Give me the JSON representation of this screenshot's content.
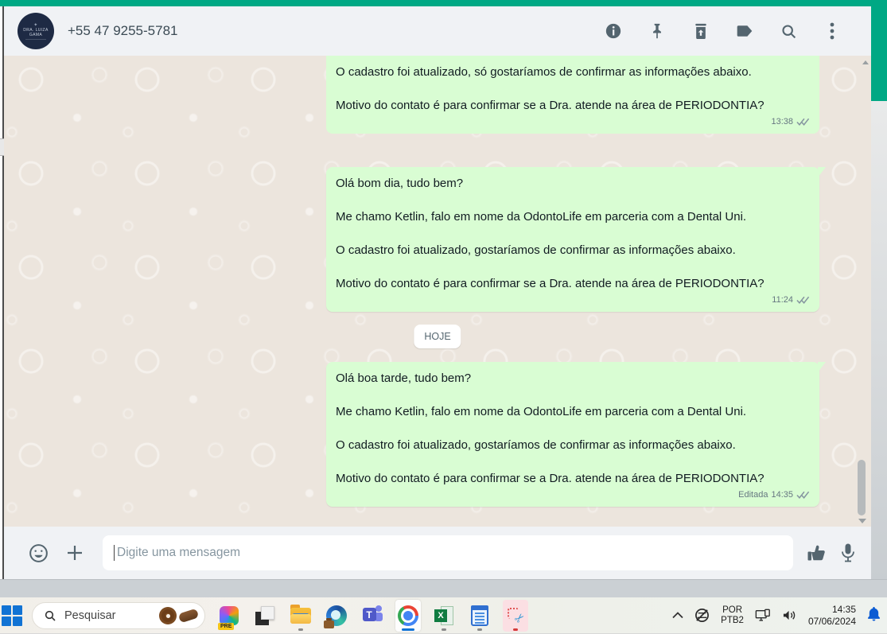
{
  "header": {
    "phone": "+55 47 9255-5781",
    "avatar_text": "DRA. LUIZA GAMA",
    "icons": [
      "info-icon",
      "pin-icon",
      "archive-icon",
      "label-icon",
      "search-icon",
      "kebab-menu-icon"
    ]
  },
  "chat": {
    "date_divider": "HOJE",
    "messages": [
      {
        "paragraphs": [
          "O cadastro foi atualizado, só gostaríamos de confirmar as informações abaixo.",
          "Motivo do contato é para confirmar se a Dra. atende na área de PERIODONTIA?"
        ],
        "time": "13:38",
        "status": "delivered"
      },
      {
        "paragraphs": [
          "Olá bom dia, tudo bem?",
          "Me chamo Ketlin, falo em nome da OdontoLife em parceria com a Dental Uni.",
          "O cadastro foi atualizado, gostaríamos de confirmar as informações abaixo.",
          "Motivo do contato é para confirmar se a Dra. atende na área de PERIODONTIA?"
        ],
        "time": "11:24",
        "status": "delivered"
      },
      {
        "paragraphs": [
          "Olá boa tarde, tudo bem?",
          "Me chamo Ketlin, falo em nome da OdontoLife em parceria com a Dental Uni.",
          "O cadastro foi atualizado, gostaríamos de confirmar as informações abaixo.",
          "Motivo do contato é para confirmar se a Dra. atende na área de PERIODONTIA?"
        ],
        "edited_label": "Editada",
        "time": "14:35",
        "status": "delivered"
      }
    ]
  },
  "composer": {
    "placeholder": "Digite uma mensagem",
    "icons": [
      "emoji-icon",
      "plus-icon",
      "thumbs-up-icon",
      "microphone-icon"
    ]
  },
  "taskbar": {
    "search_label": "Pesquisar",
    "apps": [
      "copilot",
      "squares-app",
      "file-explorer",
      "edge-work",
      "teams",
      "chrome",
      "excel",
      "notebook",
      "snipping-tool"
    ],
    "language": {
      "line1": "POR",
      "line2": "PTB2"
    },
    "clock": {
      "time": "14:35",
      "date": "07/06/2024"
    },
    "tray_icons": [
      "chevron-up-icon",
      "blocked-globe-icon",
      "cast-icon",
      "volume-icon",
      "notification-bell-icon"
    ]
  },
  "colors": {
    "accent_teal": "#00a884",
    "bubble_green": "#d9fdd3",
    "chat_background": "#ece5dd",
    "panel_gray": "#f0f2f5",
    "meta_text": "#667781",
    "icon_gray": "#54656f",
    "bell_blue": "#0b5bd3"
  }
}
